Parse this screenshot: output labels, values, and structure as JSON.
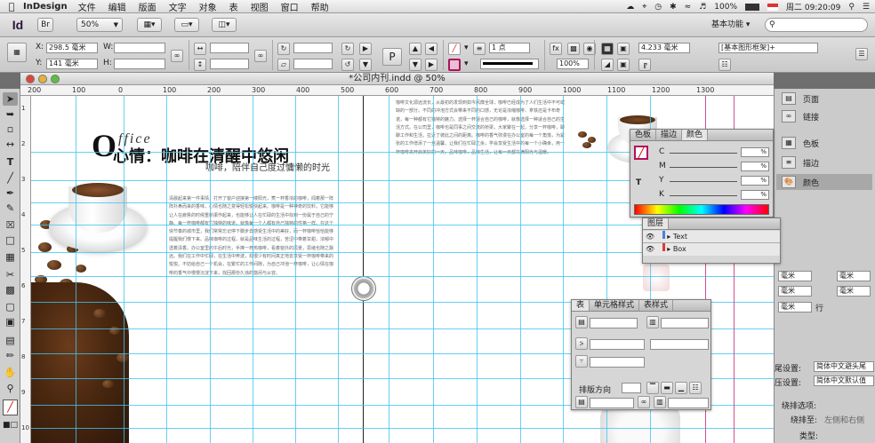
{
  "menubar": {
    "app": "InDesign",
    "items": [
      "文件",
      "编辑",
      "版面",
      "文字",
      "对象",
      "表",
      "视图",
      "窗口",
      "帮助"
    ],
    "battery": "100%",
    "clock": "周二 09:20:09"
  },
  "appbar": {
    "logo": "Id",
    "bridge": "Br",
    "zoom": "50%",
    "workspace": "基本功能",
    "search_placeholder": "ρ▾"
  },
  "control": {
    "x_label": "X:",
    "x_value": "298.5 毫米",
    "y_label": "Y:",
    "y_value": "141 毫米",
    "w_label": "W:",
    "h_label": "H:",
    "stroke_weight": "1 点",
    "opacity": "100%",
    "dimension": "4.233 毫米",
    "frame_style": "[基本图形框架]+"
  },
  "document": {
    "title": "*公司内刊.indd @ 50%",
    "ruler_marks": [
      "200",
      "100",
      "0",
      "100",
      "200",
      "300",
      "400",
      "500",
      "600",
      "700",
      "800",
      "900",
      "1000",
      "1100",
      "1200",
      "1300"
    ],
    "ruler_v_marks": [
      "1",
      "2",
      "3",
      "4",
      "5",
      "6",
      "7",
      "8",
      "9",
      "10"
    ],
    "heading_o": "O",
    "heading_ffice": "ffice",
    "heading_main": "心情：咖啡在清醒中悠闲",
    "subheading": "咖啡，陪伴自己度过慵懒的时光",
    "body_left": "清晨起来第一件事情，打开了窗户迎接第一缕阳光，煮一杯香浓的咖啡，闻着那一阵阵扑鼻而来的香味，心情也随之变得轻松愉快起来。咖啡是一种神奇的饮料，它能够让人在疲惫的时候重新振作起来，也能够让人在忙碌的生活中找到一份属于自己的宁静。每一杯咖啡都有它独特的味道，就像每一个人都有自己独特的性格一样。在这个快节奏的城市里，我们常常忘记停下脚步去感受生活中的美好，而一杯咖啡恰恰能够提醒我们慢下来。品味咖啡的过程，就是品味生活的过程，苦涩中带着甘甜，浓郁中透着清香。办公室里的午后时光，手捧一杯热咖啡，看着窗外的风景，思绪也随之飘远。我们在工作中忙碌，在生活中奔波，却很少有时间真正地去享受一杯咖啡带来的愉悦。不妨给自己一个机会，在繁忙的工作间隙，为自己冲泡一杯咖啡，让心情在咖啡的香气中慢慢沉淀下来，找回那份久违的悠闲与从容。",
    "body_right": "咖啡文化源远流长，从最初的发现到如今风靡全球，咖啡已经成为了人们生活中不可或缺的一部分。不同的冲泡方式会带来不同的口感，无论是浓缩咖啡、拿铁还是卡布奇诺，每一种都有它独特的魅力。选择一杯适合自己的咖啡，就像选择一种适合自己的生活方式。在公司里，咖啡也是同事之间交流的桥梁，大家聚在一起，分享一杯咖啡，聊聊工作和生活，拉近了彼此之间的距离。咖啡的香气弥漫在办公室的每一个角落，为紧张的工作增添了一丝温馨。让我们在忙碌之余，学会享受生活中的每一个小确幸，用一杯咖啡来开启美好的一天。品味咖啡，品味生活，让每一天都充满阳光与温暖。"
  },
  "panels": {
    "color_tabs": [
      "色板",
      "描边",
      "颜色"
    ],
    "color_channels": [
      "C",
      "M",
      "Y",
      "K"
    ],
    "color_pct": [
      "%",
      "%",
      "%",
      "%"
    ],
    "layers_title": "图层",
    "layers": [
      {
        "name": "Text",
        "color": "#4a7fe0"
      },
      {
        "name": "Box",
        "color": "#e03a3a"
      }
    ],
    "table_tabs": [
      "表",
      "单元格样式",
      "表样式"
    ],
    "table_direction": "排版方向",
    "side_items": [
      "页面",
      "链接",
      "色板",
      "描边",
      "颜色"
    ],
    "right_fields": [
      "毫米",
      "毫米",
      "毫米",
      "毫米",
      "毫米"
    ],
    "row_label": "行",
    "settings": [
      {
        "label": "尾设置:",
        "value": "简体中文避头尾"
      },
      {
        "label": "压设置:",
        "value": "简体中文默认值"
      }
    ],
    "wrap_label": "绕排选项:",
    "wrap_side_label": "绕排至:",
    "wrap_side_value": "左侧和右侧",
    "type_label": "类型:"
  },
  "colors": {
    "guide": "#40c4f0",
    "id_logo": "#2d1438",
    "coffee": "#5a3519"
  }
}
